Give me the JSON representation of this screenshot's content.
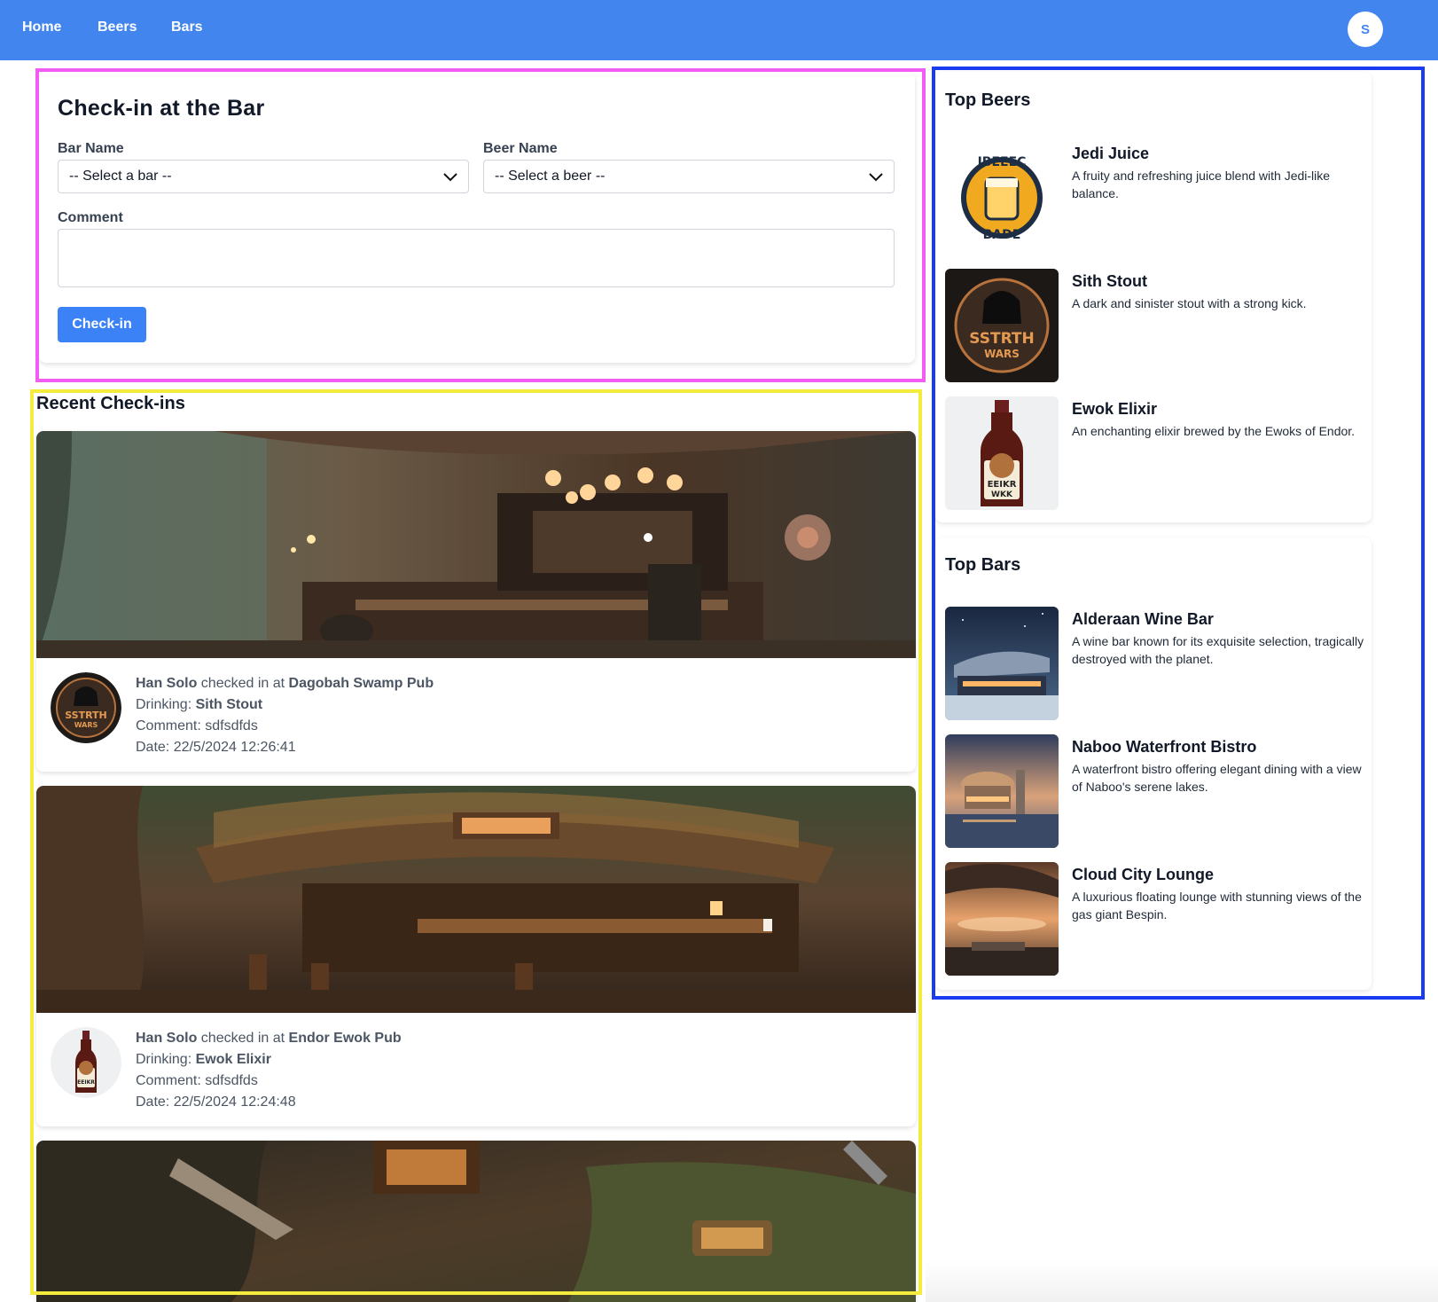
{
  "nav": {
    "links": [
      "Home",
      "Beers",
      "Bars"
    ],
    "avatar_initial": "S",
    "color": "#4285ef"
  },
  "checkin_form": {
    "title": "Check-in at the Bar",
    "bar_label": "Bar Name",
    "bar_selected": "-- Select a bar --",
    "beer_label": "Beer Name",
    "beer_selected": "-- Select a beer --",
    "comment_label": "Comment",
    "comment_value": "",
    "submit_label": "Check-in"
  },
  "recent": {
    "title": "Recent Check-ins",
    "items": [
      {
        "user": "Han Solo",
        "checked_text": " checked in at ",
        "bar": "Dagobah Swamp Pub",
        "drinking_label": "Drinking: ",
        "beer": "Sith Stout",
        "comment_line": "Comment: sdfsdfds",
        "date_line": "Date: 22/5/2024 12:26:41",
        "thumb_icon": "sith-stout-logo-icon"
      },
      {
        "user": "Han Solo",
        "checked_text": " checked in at ",
        "bar": "Endor Ewok Pub",
        "drinking_label": "Drinking: ",
        "beer": "Ewok Elixir",
        "comment_line": "Comment: sdfsdfds",
        "date_line": "Date: 22/5/2024 12:24:48",
        "thumb_icon": "ewok-elixir-bottle-icon"
      }
    ]
  },
  "top_beers": {
    "title": "Top Beers",
    "items": [
      {
        "name": "Jedi Juice",
        "desc": "A fruity and refreshing juice blend with Jedi-like balance.",
        "icon": "jedi-juice-badge-icon"
      },
      {
        "name": "Sith Stout",
        "desc": "A dark and sinister stout with a strong kick.",
        "icon": "sith-stout-logo-icon"
      },
      {
        "name": "Ewok Elixir",
        "desc": "An enchanting elixir brewed by the Ewoks of Endor.",
        "icon": "ewok-elixir-bottle-icon"
      }
    ]
  },
  "top_bars": {
    "title": "Top Bars",
    "items": [
      {
        "name": "Alderaan Wine Bar",
        "desc": "A wine bar known for its exquisite selection, tragically destroyed with the planet."
      },
      {
        "name": "Naboo Waterfront Bistro",
        "desc": "A waterfront bistro offering elegant dining with a view of Naboo's serene lakes."
      },
      {
        "name": "Cloud City Lounge",
        "desc": "A luxurious floating lounge with stunning views of the gas giant Bespin."
      }
    ]
  }
}
